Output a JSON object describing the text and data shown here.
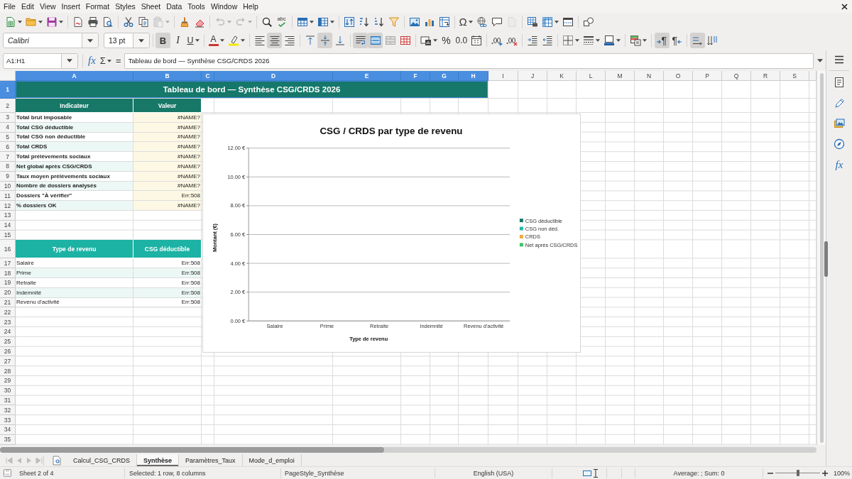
{
  "menu_bar": {
    "items": [
      "File",
      "Edit",
      "View",
      "Insert",
      "Format",
      "Styles",
      "Sheet",
      "Data",
      "Tools",
      "Window",
      "Help"
    ]
  },
  "standard_toolbar": {
    "groups": [
      [
        {
          "kind": "new",
          "disabled": false,
          "dropdown": true
        },
        {
          "kind": "open",
          "disabled": false,
          "dropdown": true
        },
        {
          "kind": "save",
          "disabled": false,
          "dropdown": true
        }
      ],
      [
        {
          "kind": "pdf",
          "disabled": false
        },
        {
          "kind": "print",
          "disabled": false
        },
        {
          "kind": "preview",
          "disabled": false
        }
      ],
      [
        {
          "kind": "cut",
          "disabled": false
        },
        {
          "kind": "copy",
          "disabled": false
        },
        {
          "kind": "paste",
          "disabled": true,
          "dropdown": true
        }
      ],
      [
        {
          "kind": "brush",
          "disabled": false
        },
        {
          "kind": "eraser",
          "disabled": false
        }
      ],
      [
        {
          "kind": "undo",
          "disabled": true,
          "dropdown": true
        },
        {
          "kind": "redo",
          "disabled": true,
          "dropdown": true
        }
      ],
      [
        {
          "kind": "find",
          "disabled": false
        },
        {
          "kind": "spelling",
          "label": "abc",
          "disabled": false
        }
      ],
      [
        {
          "kind": "rows",
          "disabled": false,
          "dropdown": true
        },
        {
          "kind": "columns",
          "disabled": false,
          "dropdown": true
        }
      ],
      [
        {
          "kind": "sort",
          "disabled": false
        },
        {
          "kind": "ascending",
          "disabled": false
        },
        {
          "kind": "descending",
          "disabled": false
        },
        {
          "kind": "filter",
          "disabled": false
        }
      ],
      [
        {
          "kind": "image",
          "disabled": false
        },
        {
          "kind": "chart",
          "disabled": false
        },
        {
          "kind": "pivot",
          "disabled": false
        }
      ],
      [
        {
          "kind": "symbol",
          "label": "Ω",
          "disabled": false,
          "dropdown": true
        },
        {
          "kind": "link",
          "disabled": false
        },
        {
          "kind": "comment",
          "disabled": false
        },
        {
          "kind": "header",
          "disabled": true
        }
      ],
      [
        {
          "kind": "printarea",
          "disabled": false
        },
        {
          "kind": "freeze",
          "disabled": false,
          "dropdown": true
        },
        {
          "kind": "split",
          "disabled": false
        }
      ],
      [
        {
          "kind": "shapes",
          "disabled": false
        }
      ]
    ]
  },
  "formatting_toolbar": {
    "font_name": "Calibri",
    "font_size": "13 pt",
    "groups": [
      [
        {
          "kind": "bold",
          "label": "B",
          "on": true
        },
        {
          "kind": "italic",
          "label": "I",
          "on": false
        },
        {
          "kind": "underline",
          "label": "U",
          "on": false,
          "dropdown": true
        }
      ],
      [
        {
          "kind": "fontcolor",
          "label": "A",
          "on": false,
          "dropdown": true
        },
        {
          "kind": "highlight",
          "on": false,
          "dropdown": true
        }
      ],
      [
        {
          "kind": "left",
          "on": false
        },
        {
          "kind": "center",
          "on": true
        },
        {
          "kind": "right",
          "on": false
        }
      ],
      [
        {
          "kind": "top",
          "on": false
        },
        {
          "kind": "middle",
          "on": true
        },
        {
          "kind": "bottom",
          "on": false
        }
      ],
      [
        {
          "kind": "wrap",
          "on": true
        },
        {
          "kind": "merge",
          "on": true
        },
        {
          "kind": "mergecells",
          "on": false
        },
        {
          "kind": "unmerge",
          "on": false
        }
      ],
      [
        {
          "kind": "currency",
          "on": false,
          "dropdown": true
        },
        {
          "kind": "percent",
          "label": "%",
          "on": false
        },
        {
          "kind": "number",
          "label": "0.0",
          "on": false
        },
        {
          "kind": "date",
          "on": false
        }
      ],
      [
        {
          "kind": "adddecimal",
          "on": false
        },
        {
          "kind": "deldecimal",
          "on": false
        }
      ],
      [
        {
          "kind": "indent",
          "on": false
        },
        {
          "kind": "outdent",
          "on": false
        }
      ],
      [
        {
          "kind": "borders",
          "on": false,
          "dropdown": true
        },
        {
          "kind": "borderstyle",
          "on": false,
          "dropdown": true
        },
        {
          "kind": "bordercolor",
          "on": false,
          "dropdown": true
        }
      ],
      [
        {
          "kind": "conditional",
          "on": false,
          "dropdown": true
        }
      ],
      [
        {
          "kind": "ltr",
          "label": "¶",
          "on": true
        },
        {
          "kind": "rtl",
          "label": "¶",
          "on": false
        }
      ],
      [
        {
          "kind": "horizontal",
          "on": true
        },
        {
          "kind": "vertical",
          "on": false
        }
      ]
    ]
  },
  "formula_bar": {
    "name_box": "A1:H1",
    "function_wizard": "fx",
    "sum": "Σ",
    "formula": "=",
    "content": "Tableau de bord — Synthèse CSG/CRDS 2026"
  },
  "sidebar": {
    "buttons": [
      {
        "kind": "properties"
      },
      {
        "kind": "styles"
      },
      {
        "kind": "gallery"
      },
      {
        "kind": "navigator"
      },
      {
        "kind": "functions",
        "label": "fx"
      }
    ]
  },
  "sheet": {
    "column_headers": [
      {
        "label": "A",
        "selected": true
      },
      {
        "label": "B",
        "selected": true
      },
      {
        "label": "C",
        "selected": true
      },
      {
        "label": "D",
        "selected": true
      },
      {
        "label": "E",
        "selected": true
      },
      {
        "label": "F",
        "selected": true
      },
      {
        "label": "G",
        "selected": true
      },
      {
        "label": "H",
        "selected": true
      },
      {
        "label": "I",
        "selected": false
      },
      {
        "label": "J",
        "selected": false
      },
      {
        "label": "K",
        "selected": false
      },
      {
        "label": "L",
        "selected": false
      },
      {
        "label": "M",
        "selected": false
      },
      {
        "label": "N",
        "selected": false
      },
      {
        "label": "O",
        "selected": false
      },
      {
        "label": "P",
        "selected": false
      },
      {
        "label": "Q",
        "selected": false
      },
      {
        "label": "R",
        "selected": false
      },
      {
        "label": "S",
        "selected": false
      }
    ],
    "row_headers": [
      {
        "label": "1",
        "selected": true
      },
      {
        "label": "2",
        "selected": false
      },
      {
        "label": "3",
        "selected": false
      },
      {
        "label": "4",
        "selected": false
      },
      {
        "label": "5",
        "selected": false
      },
      {
        "label": "6",
        "selected": false
      },
      {
        "label": "7",
        "selected": false
      },
      {
        "label": "8",
        "selected": false
      },
      {
        "label": "9",
        "selected": false
      },
      {
        "label": "10",
        "selected": false
      },
      {
        "label": "11",
        "selected": false
      },
      {
        "label": "12",
        "selected": false
      },
      {
        "label": "13",
        "selected": false
      },
      {
        "label": "14",
        "selected": false
      },
      {
        "label": "15",
        "selected": false
      },
      {
        "label": "16",
        "selected": false
      },
      {
        "label": "17",
        "selected": false
      },
      {
        "label": "18",
        "selected": false
      },
      {
        "label": "19",
        "selected": false
      },
      {
        "label": "20",
        "selected": false
      },
      {
        "label": "21",
        "selected": false
      },
      {
        "label": "22",
        "selected": false
      },
      {
        "label": "23",
        "selected": false
      },
      {
        "label": "24",
        "selected": false
      },
      {
        "label": "25",
        "selected": false
      },
      {
        "label": "26",
        "selected": false
      },
      {
        "label": "27",
        "selected": false
      },
      {
        "label": "28",
        "selected": false
      },
      {
        "label": "29",
        "selected": false
      },
      {
        "label": "30",
        "selected": false
      },
      {
        "label": "31",
        "selected": false
      },
      {
        "label": "32",
        "selected": false
      },
      {
        "label": "33",
        "selected": false
      },
      {
        "label": "34",
        "selected": false
      },
      {
        "label": "35",
        "selected": false
      }
    ],
    "title": "Tableau de bord — Synthèse CSG/CRDS 2026",
    "summary_table": {
      "columns": [
        "Indicateur",
        "Valeur"
      ],
      "rows": [
        {
          "label": "Total brut imposable",
          "value": "#NAME?"
        },
        {
          "label": "Total CSG déductible",
          "value": "#NAME?"
        },
        {
          "label": "Total CSG non déductible",
          "value": "#NAME?"
        },
        {
          "label": "Total CRDS",
          "value": "#NAME?"
        },
        {
          "label": "Total prélèvements sociaux",
          "value": "#NAME?"
        },
        {
          "label": "Net global après CSG/CRDS",
          "value": "#NAME?"
        },
        {
          "label": "Taux moyen prélèvements sociaux",
          "value": "#NAME?"
        },
        {
          "label": "Nombre de dossiers analysés",
          "value": "#NAME?"
        },
        {
          "label": "Dossiers \"À vérifier\"",
          "value": "Err:508"
        },
        {
          "label": "% dossiers OK",
          "value": "#NAME?"
        }
      ]
    },
    "revenue_table": {
      "columns": [
        "Type de revenu",
        "CSG déductible"
      ],
      "rows": [
        {
          "label": "Salaire",
          "value": "Err:508"
        },
        {
          "label": "Prime",
          "value": "Err:508"
        },
        {
          "label": "Retraite",
          "value": "Err:508"
        },
        {
          "label": "Indemnité",
          "value": "Err:508"
        },
        {
          "label": "Revenu d'activité",
          "value": "Err:508"
        }
      ]
    },
    "chart": {
      "chart_data": {
        "type": "bar",
        "title": "CSG / CRDS par type de revenu",
        "xlabel": "Type de revenu",
        "ylabel": "Montant (€)",
        "categories": [
          "Salaire",
          "Prime",
          "Retraite",
          "Indemnité",
          "Revenu d'activité"
        ],
        "series": [
          {
            "name": "CSG déductible",
            "color": "#16786a",
            "values": [
              0,
              0,
              0,
              0,
              0
            ]
          },
          {
            "name": "CSG non déd.",
            "color": "#25b6a8",
            "values": [
              0,
              0,
              0,
              0,
              0
            ]
          },
          {
            "name": "CRDS",
            "color": "#f2a93b",
            "values": [
              0,
              0,
              0,
              0,
              0
            ]
          },
          {
            "name": "Net après CSG/CRDS",
            "color": "#3cc46a",
            "values": [
              0,
              0,
              0,
              0,
              0
            ]
          }
        ],
        "ylim": [
          0,
          12
        ],
        "yticks": [
          {
            "value": 0,
            "label": "0.00 €"
          },
          {
            "value": 2,
            "label": "2.00 €"
          },
          {
            "value": 4,
            "label": "4.00 €"
          },
          {
            "value": 6,
            "label": "6.00 €"
          },
          {
            "value": 8,
            "label": "8.00 €"
          },
          {
            "value": 10,
            "label": "10.00 €"
          },
          {
            "value": 12,
            "label": "12.00 €"
          }
        ],
        "grid": true
      }
    }
  },
  "sheet_tabs": [
    {
      "label": "Calcul_CSG_CRDS",
      "selected": false
    },
    {
      "label": "Synthèse",
      "selected": true
    },
    {
      "label": "Paramètres_Taux",
      "selected": false
    },
    {
      "label": "Mode_d_emploi",
      "selected": false
    }
  ],
  "status_bar": {
    "sheet": "Sheet 2 of 4",
    "selection": "Selected: 1 row, 8 columns",
    "page_style": "PageStyle_Synthèse",
    "language": "English (USA)",
    "summary": "Average: ; Sum: 0",
    "zoom": {
      "level": 0.5,
      "label": "100%"
    }
  }
}
